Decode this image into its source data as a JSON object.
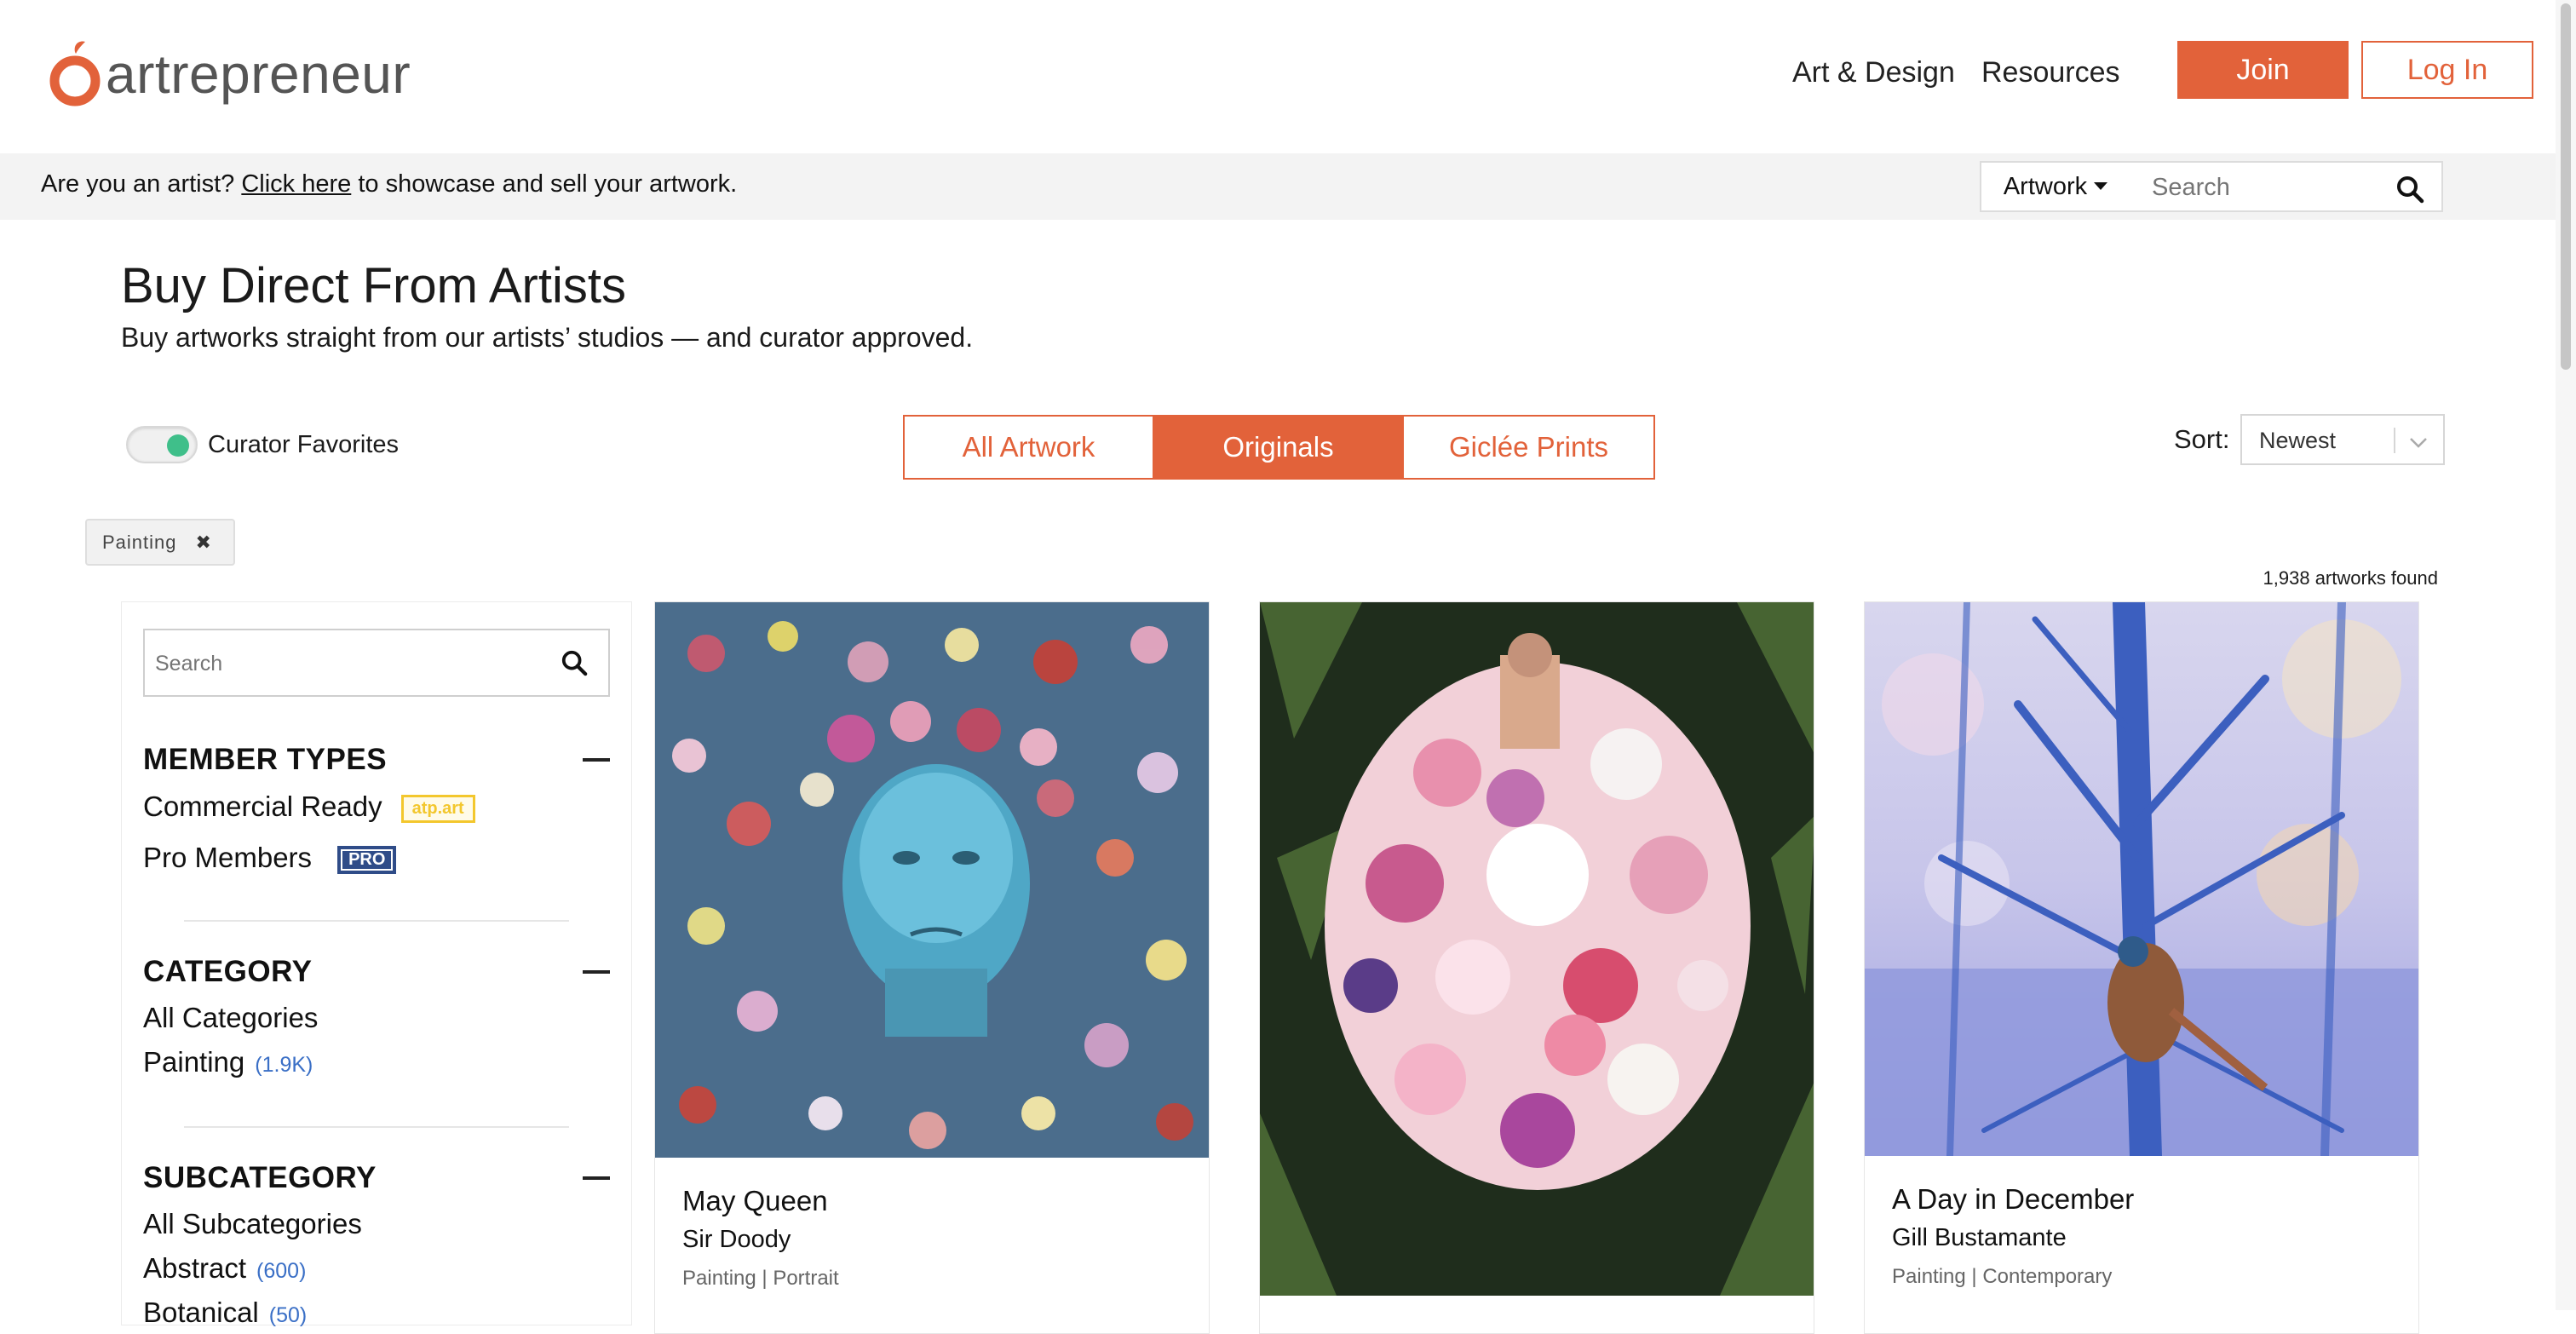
{
  "brand": {
    "name": "artrepreneur",
    "color": "#e2623a"
  },
  "nav": {
    "links": [
      "Art & Design",
      "Resources"
    ],
    "join": "Join",
    "login": "Log In"
  },
  "promo": {
    "prefix": "Are you an artist? ",
    "link": "Click here",
    "suffix": " to showcase and sell your artwork."
  },
  "search": {
    "type": "Artwork",
    "placeholder": "Search"
  },
  "page": {
    "title": "Buy Direct From Artists",
    "subtitle": "Buy artworks straight from our artists’ studios — and curator approved."
  },
  "toggle": {
    "label": "Curator Favorites",
    "on": true
  },
  "tabs": [
    {
      "label": "All Artwork",
      "active": false
    },
    {
      "label": "Originals",
      "active": true
    },
    {
      "label": "Giclée Prints",
      "active": false
    }
  ],
  "sort": {
    "label": "Sort:",
    "value": "Newest"
  },
  "chip": {
    "label": "Painting"
  },
  "results": {
    "count_text": "1,938 artworks found"
  },
  "sidebar": {
    "search_placeholder": "Search",
    "member_types": {
      "title": "MEMBER TYPES",
      "items": [
        {
          "label": "Commercial Ready",
          "badge": "atp.art"
        },
        {
          "label": "Pro Members",
          "badge": "PRO"
        }
      ]
    },
    "category": {
      "title": "CATEGORY",
      "items": [
        {
          "label": "All Categories"
        },
        {
          "label": "Painting",
          "count": "(1.9K)"
        }
      ]
    },
    "subcategory": {
      "title": "SUBCATEGORY",
      "items": [
        {
          "label": "All Subcategories"
        },
        {
          "label": "Abstract",
          "count": "(600)"
        },
        {
          "label": "Botanical",
          "count": "(50)"
        }
      ]
    }
  },
  "cards": [
    {
      "title": "May Queen",
      "artist": "Sir Doody",
      "medium": "Painting",
      "style": "Portrait"
    },
    {
      "title": "",
      "artist": "",
      "medium": "",
      "style": ""
    },
    {
      "title": "A Day in December",
      "artist": "Gill Bustamante",
      "medium": "Painting",
      "style": "Contemporary"
    }
  ]
}
